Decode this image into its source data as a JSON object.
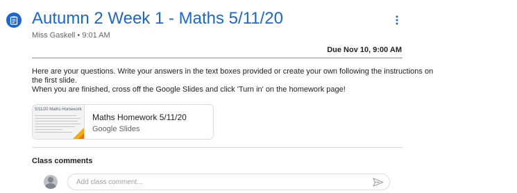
{
  "assignment": {
    "icon": "assignment-icon",
    "title": "Autumn 2 Week 1 - Maths 5/11/20",
    "author": "Miss Gaskell",
    "separator": "•",
    "time": "9:01 AM",
    "due": "Due Nov 10, 9:00 AM",
    "more_icon": "more-vertical-icon"
  },
  "instructions": [
    "Here are your questions. Write your answers in the text boxes provided or create your own following the instructions on",
    "the first slide.",
    "When you are finished, cross off the Google Slides and click 'Turn in' on the homework page!"
  ],
  "attachment": {
    "thumbnail_title": "5/11/20 Maths Homework",
    "name": "Maths Homework 5/11/20",
    "type": "Google Slides"
  },
  "comments": {
    "label": "Class comments",
    "placeholder": "Add class comment...",
    "send_icon": "send-icon"
  },
  "colors": {
    "accent": "#1967d2",
    "slides_yellow": "#f9ab00"
  }
}
